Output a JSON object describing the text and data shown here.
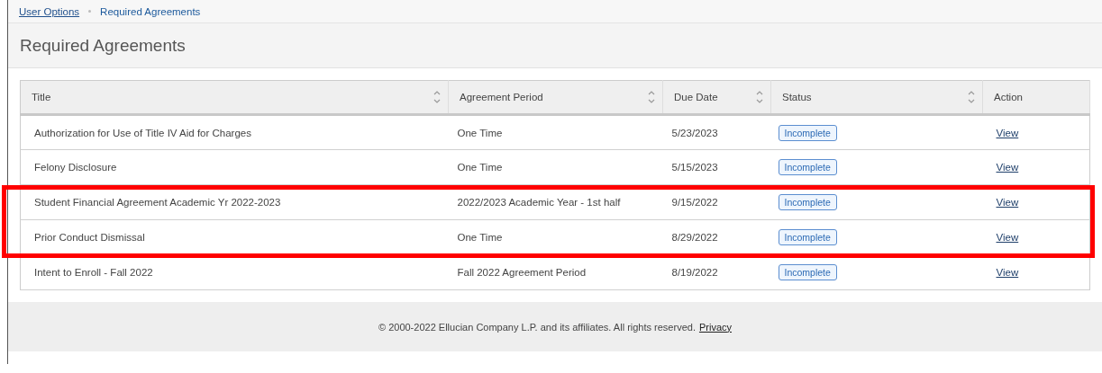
{
  "breadcrumb": [
    {
      "label": "User Options",
      "link": true
    },
    {
      "label": "Required Agreements",
      "link": false
    }
  ],
  "page_title": "Required Agreements",
  "table": {
    "columns": [
      {
        "label": "Title",
        "sortable": true
      },
      {
        "label": "Agreement Period",
        "sortable": true
      },
      {
        "label": "Due Date",
        "sortable": true
      },
      {
        "label": "Status",
        "sortable": true
      },
      {
        "label": "Action",
        "sortable": false
      }
    ],
    "rows": [
      {
        "title": "Authorization for Use of Title IV Aid for Charges",
        "period": "One Time",
        "due": "5/23/2023",
        "status": "Incomplete",
        "action": "View",
        "highlighted": false
      },
      {
        "title": "Felony Disclosure",
        "period": "One Time",
        "due": "5/15/2023",
        "status": "Incomplete",
        "action": "View",
        "highlighted": false
      },
      {
        "title": "Student Financial Agreement Academic Yr 2022-2023",
        "period": "2022/2023 Academic Year - 1st half",
        "due": "9/15/2022",
        "status": "Incomplete",
        "action": "View",
        "highlighted": true
      },
      {
        "title": "Prior Conduct Dismissal",
        "period": "One Time",
        "due": "8/29/2022",
        "status": "Incomplete",
        "action": "View",
        "highlighted": true
      },
      {
        "title": "Intent to Enroll - Fall 2022",
        "period": "Fall 2022 Agreement Period",
        "due": "8/19/2022",
        "status": "Incomplete",
        "action": "View",
        "highlighted": false
      }
    ]
  },
  "footer": {
    "text": "© 2000-2022 Ellucian Company L.P. and its affiliates. All rights reserved.",
    "link": "Privacy"
  }
}
